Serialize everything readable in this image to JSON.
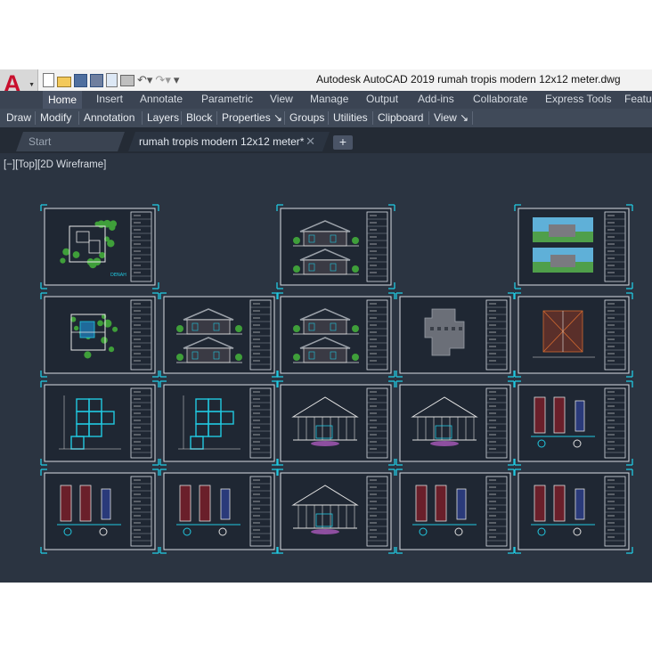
{
  "app": {
    "title": "Autodesk AutoCAD 2019    rumah tropis modern 12x12 meter.dwg",
    "logo_letter": "A",
    "quick_access_icons": [
      "new-icon",
      "open-icon",
      "save-icon",
      "save-as-icon",
      "plot-preview-icon",
      "print-icon",
      "undo-icon",
      "redo-icon",
      "customize-caret-icon"
    ]
  },
  "ribbon_tabs": [
    "Home",
    "Insert",
    "Annotate",
    "Parametric",
    "View",
    "Manage",
    "Output",
    "Add-ins",
    "Collaborate",
    "Express Tools",
    "Featu"
  ],
  "active_tab": "Home",
  "panels": [
    "Draw",
    "Modify",
    "Annotation",
    "Layers",
    "Block",
    "Properties ↘",
    "Groups",
    "Utilities",
    "Clipboard",
    "View ↘"
  ],
  "document_tabs": {
    "start": "Start",
    "active": "rumah tropis modern 12x12 meter*",
    "close_glyph": "✕",
    "new_tab_glyph": "+"
  },
  "viewport_label": "[−][Top][2D Wireframe]",
  "site_plan_caption": "DENAH",
  "colors": {
    "ribbon_bg": "#3b4453",
    "canvas_bg": "#2b3441",
    "sheet_bg": "#1f2733",
    "selection_cyan": "#21c8e0",
    "logo_red": "#c8102e"
  },
  "drawing_sheets": [
    {
      "row": 1,
      "col": 1,
      "content": "site-plan"
    },
    {
      "row": 1,
      "col": 3,
      "content": "elevations"
    },
    {
      "row": 1,
      "col": 5,
      "content": "3d-render"
    },
    {
      "row": 2,
      "col": 1,
      "content": "floor-plan"
    },
    {
      "row": 2,
      "col": 2,
      "content": "elevations"
    },
    {
      "row": 2,
      "col": 3,
      "content": "elevations"
    },
    {
      "row": 2,
      "col": 4,
      "content": "foundation-plan"
    },
    {
      "row": 2,
      "col": 5,
      "content": "roof-plan"
    },
    {
      "row": 3,
      "col": 1,
      "content": "structure-plan"
    },
    {
      "row": 3,
      "col": 2,
      "content": "structure-plan"
    },
    {
      "row": 3,
      "col": 3,
      "content": "sections"
    },
    {
      "row": 3,
      "col": 4,
      "content": "sections"
    },
    {
      "row": 3,
      "col": 5,
      "content": "details"
    },
    {
      "row": 4,
      "col": 1,
      "content": "details"
    },
    {
      "row": 4,
      "col": 2,
      "content": "details"
    },
    {
      "row": 4,
      "col": 3,
      "content": "sections"
    },
    {
      "row": 4,
      "col": 4,
      "content": "details"
    },
    {
      "row": 4,
      "col": 5,
      "content": "details"
    }
  ]
}
